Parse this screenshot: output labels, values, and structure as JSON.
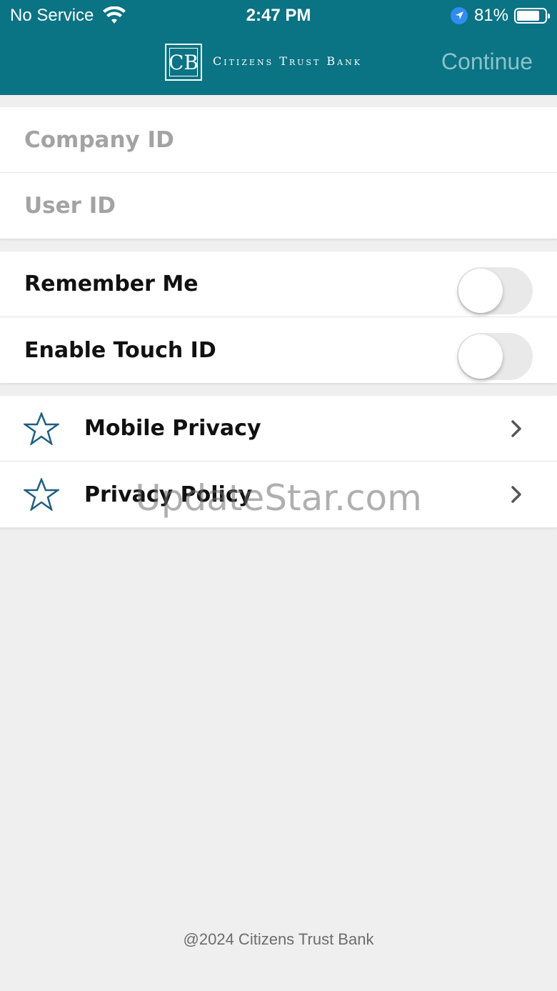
{
  "status_bar": {
    "carrier": "No Service",
    "time": "2:47 PM",
    "battery": "81%",
    "battery_level": 0.81
  },
  "header": {
    "brand_name": "Citizens Trust Bank",
    "logo_letters": "CB",
    "continue_label": "Continue"
  },
  "login": {
    "company_id_placeholder": "Company ID",
    "company_id_value": "",
    "user_id_placeholder": "User ID",
    "user_id_value": ""
  },
  "settings": {
    "remember_me_label": "Remember Me",
    "remember_me_on": false,
    "touch_id_label": "Enable Touch ID",
    "touch_id_on": false
  },
  "links": {
    "items": [
      {
        "label": "Mobile Privacy",
        "icon": "star-icon"
      },
      {
        "label": "Privacy Policy",
        "icon": "star-icon"
      }
    ]
  },
  "watermark": "UpdateStar.com",
  "footer": "@2024 Citizens Trust Bank",
  "colors": {
    "header_bg": "#0a7384",
    "continue_disabled": "#8ac2cb",
    "star": "#1f5f80"
  }
}
